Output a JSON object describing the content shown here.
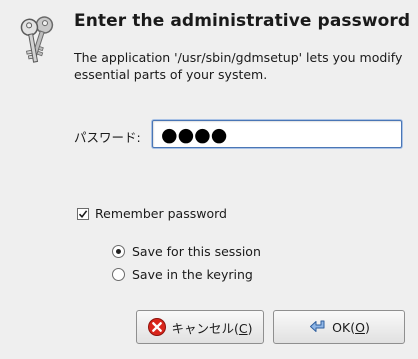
{
  "dialog": {
    "title": "Enter the administrative password",
    "description": "The application '/usr/sbin/gdmsetup' lets you modify essential parts of your system."
  },
  "password": {
    "label": "パスワード:",
    "value": "●●●●"
  },
  "remember": {
    "label": "Remember password",
    "checked": true
  },
  "options": [
    {
      "label": "Save for this session",
      "selected": true
    },
    {
      "label": "Save in the keyring",
      "selected": false
    }
  ],
  "buttons": {
    "cancel": {
      "label_prefix": "キャンセル(",
      "accel": "C",
      "label_suffix": ")",
      "icon": "cancel-icon"
    },
    "ok": {
      "label_prefix": "OK(",
      "accel": "O",
      "label_suffix": ")",
      "icon": "ok-arrow-icon"
    }
  },
  "colors": {
    "background": "#efefef",
    "focus_border": "#4a76b5",
    "cancel_red": "#d9261c"
  },
  "icons": {
    "dialog": "keys-icon"
  }
}
